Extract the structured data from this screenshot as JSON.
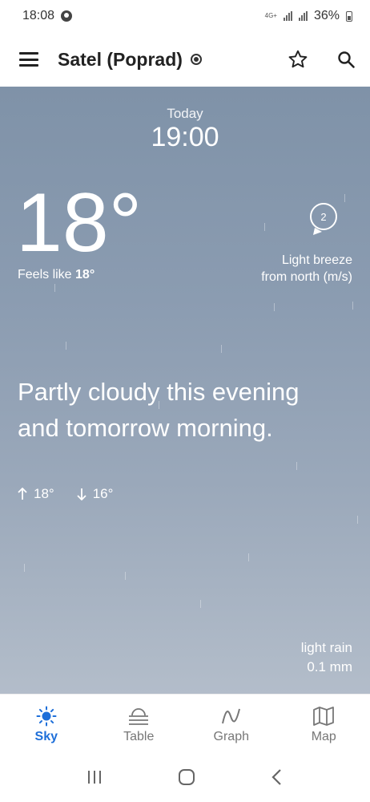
{
  "status_bar": {
    "time": "18:08",
    "network": "4G+",
    "battery": "36%"
  },
  "app_bar": {
    "location": "Satel (Poprad)"
  },
  "forecast": {
    "day": "Today",
    "time": "19:00",
    "temperature": "18°",
    "feels_like_label": "Feels like",
    "feels_like_value": "18°",
    "wind_speed": "2",
    "wind_line1": "Light breeze",
    "wind_line2": "from north (m/s)",
    "summary": "Partly cloudy this evening and tomorrow morning.",
    "high": "18°",
    "low": "16°",
    "precip_type": "light rain",
    "precip_amount": "0.1 mm"
  },
  "bottom_nav": [
    {
      "label": "Sky",
      "icon": "sun-icon"
    },
    {
      "label": "Table",
      "icon": "table-icon"
    },
    {
      "label": "Graph",
      "icon": "graph-icon"
    },
    {
      "label": "Map",
      "icon": "map-icon"
    }
  ],
  "colors": {
    "accent": "#1e6fd9",
    "sky_top": "#7f92a8",
    "sky_bottom": "#b3bdca"
  }
}
